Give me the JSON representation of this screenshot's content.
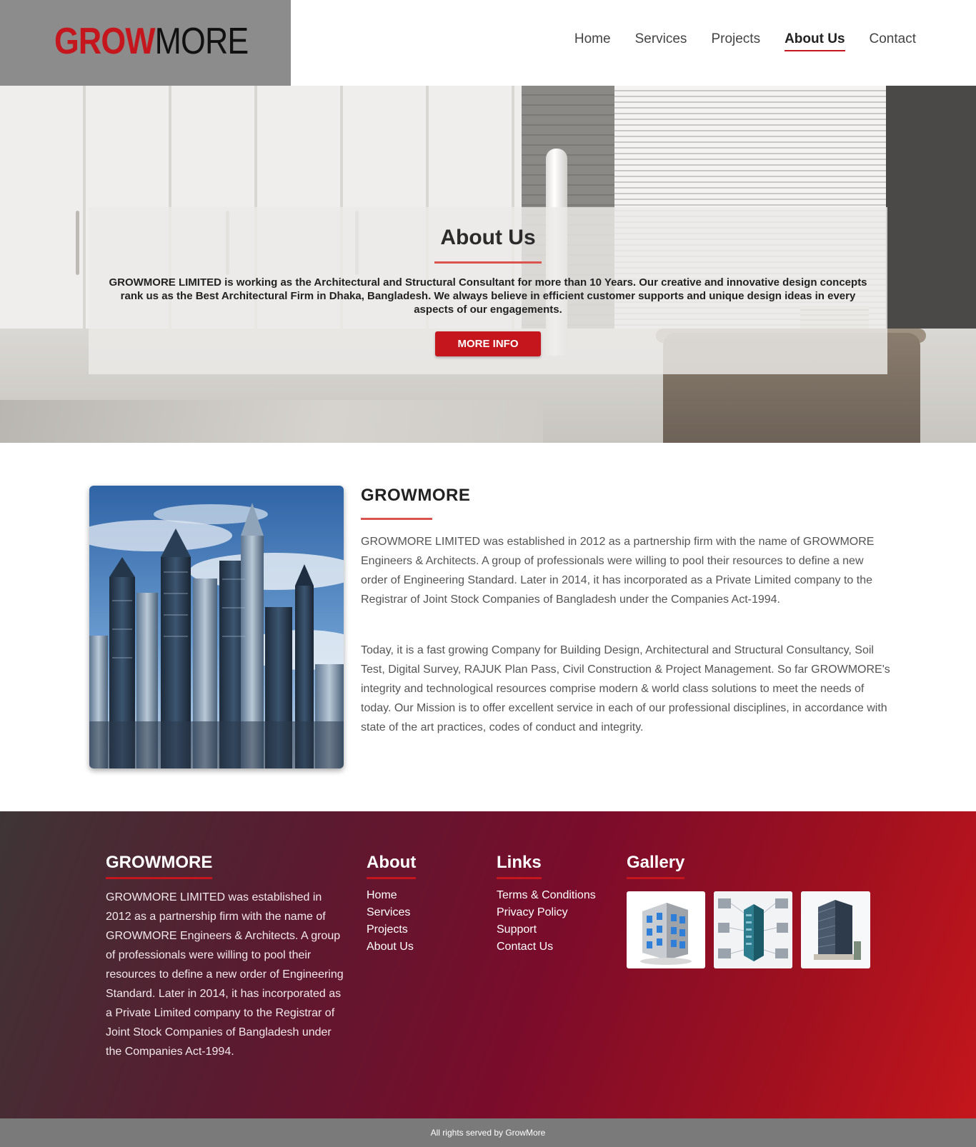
{
  "colors": {
    "accent": "#c4161c",
    "logo_box": "#8c8c8c",
    "rule": "#d9534f",
    "footer_start": "#3e3536",
    "footer_end": "#c4161c",
    "copyright_bar": "#7a7a7a"
  },
  "brand": {
    "logo_part_1": "GROW",
    "logo_part_2": "MORE"
  },
  "nav": {
    "items": [
      {
        "label": "Home",
        "active": false
      },
      {
        "label": "Services",
        "active": false
      },
      {
        "label": "Projects",
        "active": false
      },
      {
        "label": "About Us",
        "active": true
      },
      {
        "label": "Contact",
        "active": false
      }
    ]
  },
  "hero": {
    "title": "About Us",
    "text": "GROWMORE LIMITED is working as the Architectural and Structural Consultant for more than 10 Years. Our creative and innovative design concepts rank us as the Best Architectural Firm in Dhaka, Bangladesh. We always believe in efficient customer supports and unique design ideas in every aspects of our engagements.",
    "button_label": "MORE INFO"
  },
  "about": {
    "title": "GROWMORE",
    "paragraph_1": "GROWMORE LIMITED was established in 2012 as a partnership firm with the name of GROWMORE Engineers & Architects. A group of professionals were willing to pool their resources to define a new order of Engineering Standard. Later in 2014, it has incorporated as a Private Limited company to the Registrar of Joint Stock Companies of Bangladesh under the Companies Act-1994.",
    "paragraph_2": "Today, it is a fast growing Company for Building Design, Architectural and Structural Consultancy, Soil Test, Digital Survey, RAJUK Plan Pass, Civil Construction & Project Management. So far GROWMORE's integrity and technological resources comprise modern & world class solutions to meet the needs of today. Our Mission is to offer excellent service in each of our professional disciplines, in accordance with state of the art practices, codes of conduct and integrity."
  },
  "footer": {
    "company": {
      "heading": "GROWMORE",
      "text": "GROWMORE LIMITED was established in 2012 as a partnership firm with the name of GROWMORE Engineers & Architects. A group of professionals were willing to pool their resources to define a new order of Engineering Standard. Later in 2014, it has incorporated as a Private Limited company to the Registrar of Joint Stock Companies of Bangladesh under the Companies Act-1994."
    },
    "about": {
      "heading": "About",
      "links": [
        "Home",
        "Services",
        "Projects",
        "About Us"
      ]
    },
    "links": {
      "heading": "Links",
      "links": [
        "Terms & Conditions",
        "Privacy Policy",
        "Support",
        "Contact Us"
      ]
    },
    "gallery": {
      "heading": "Gallery",
      "images": [
        "office-building-icon",
        "isometric-city-icon",
        "skyscraper-photo"
      ]
    }
  },
  "copyright": "All rights served by GrowMore"
}
